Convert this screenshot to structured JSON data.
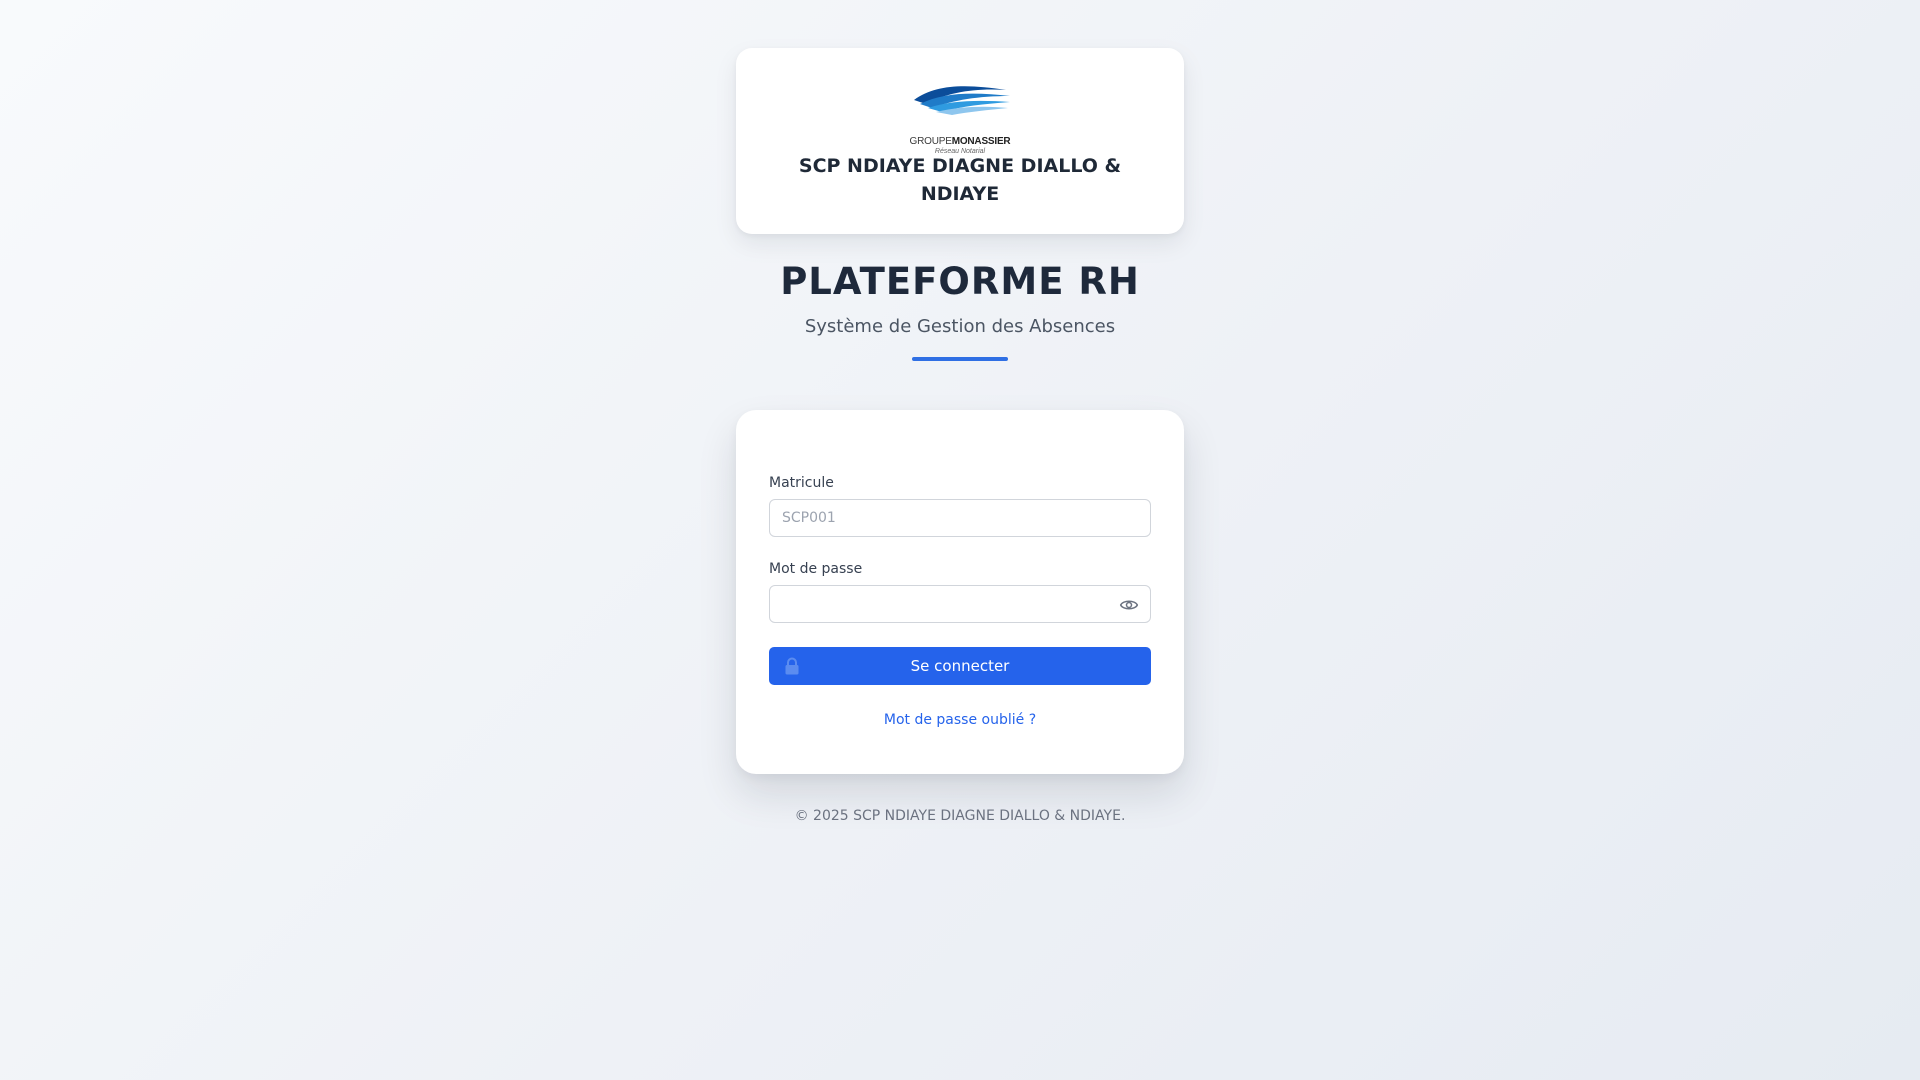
{
  "brand": {
    "logo_text_prefix": "GROUPE",
    "logo_text_bold": "MONASSIER",
    "logo_subtext": "Réseau Notarial",
    "firm_name": "SCP NDIAYE DIAGNE DIALLO & NDIAYE",
    "logo_colors": [
      "#0b4d9a",
      "#1f7bc8",
      "#2f9be0"
    ]
  },
  "header": {
    "title": "PLATEFORME RH",
    "subtitle": "Système de Gestion des Absences",
    "accent_color": "#2f6fe4"
  },
  "login": {
    "matricule_label": "Matricule",
    "matricule_placeholder": "SCP001",
    "matricule_value": "",
    "password_label": "Mot de passe",
    "password_value": "",
    "password_toggle_icon": "eye-icon",
    "submit_label": "Se connecter",
    "submit_icon": "lock-icon",
    "forgot_link": "Mot de passe oublié ?",
    "button_color": "#2563eb"
  },
  "footer": {
    "copyright": "© 2025 SCP NDIAYE DIAGNE DIALLO & NDIAYE."
  }
}
